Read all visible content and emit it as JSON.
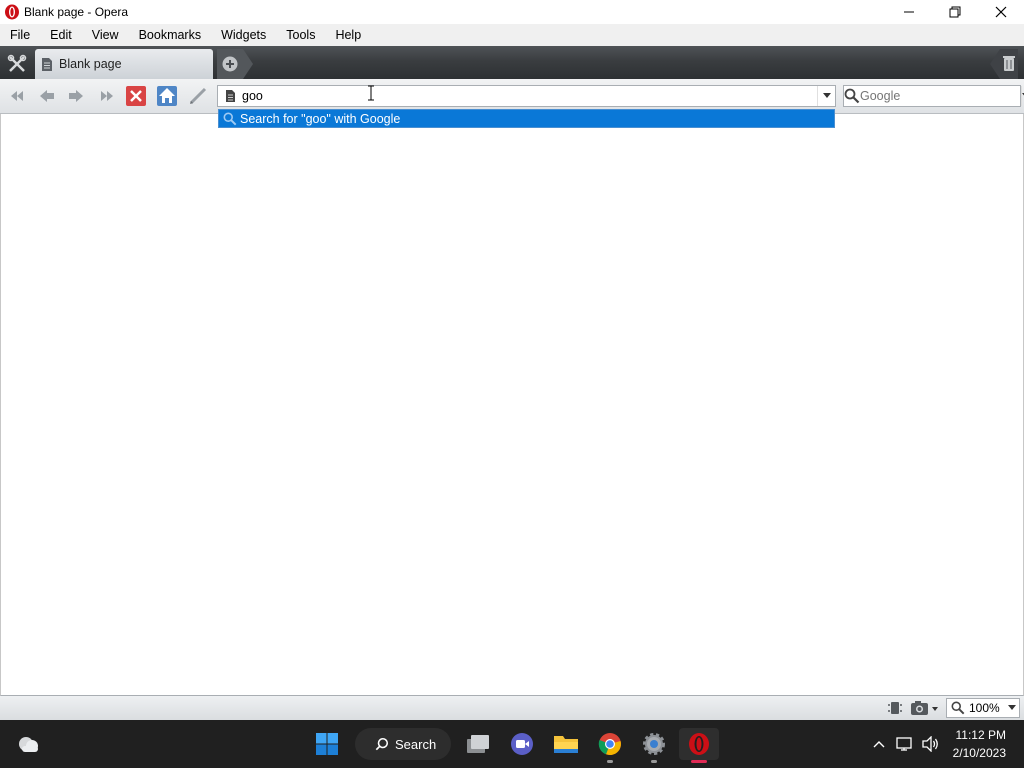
{
  "window": {
    "title": "Blank page - Opera"
  },
  "menu": [
    "File",
    "Edit",
    "View",
    "Bookmarks",
    "Widgets",
    "Tools",
    "Help"
  ],
  "tabs": [
    {
      "label": "Blank page",
      "active": true
    }
  ],
  "address": {
    "value": "goo"
  },
  "search": {
    "placeholder": "Google",
    "engine": "Google"
  },
  "suggestion": {
    "label": "Search for \"goo\" with Google"
  },
  "statusbar": {
    "zoom": "100%"
  },
  "taskbar": {
    "search_label": "Search",
    "clock_time": "11:12 PM",
    "clock_date": "2/10/2023"
  },
  "colors": {
    "accent": "#0a78d7",
    "taskbar_bg": "#202020",
    "tab_bar": "#3a3d40",
    "opera_red": "#cc0f16"
  }
}
